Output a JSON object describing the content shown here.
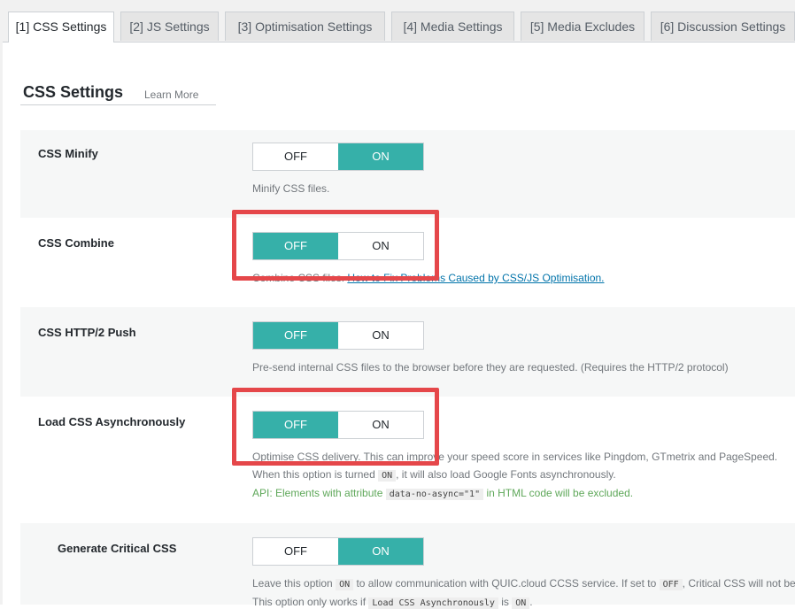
{
  "tabs": [
    {
      "label": "[1] CSS Settings"
    },
    {
      "label": "[2] JS Settings"
    },
    {
      "label": "[3] Optimisation Settings"
    },
    {
      "label": "[4] Media Settings"
    },
    {
      "label": "[5] Media Excludes"
    },
    {
      "label": "[6] Discussion Settings"
    }
  ],
  "section": {
    "title": "CSS Settings",
    "learn_more": "Learn More"
  },
  "toggle_labels": {
    "off": "OFF",
    "on": "ON"
  },
  "settings": [
    {
      "label": "CSS Minify",
      "state": "ON",
      "desc": "Minify CSS files."
    },
    {
      "label": "CSS Combine",
      "state": "OFF",
      "desc_prefix": "Combine CSS files.",
      "desc_link": "How to Fix Problems Caused by CSS/JS Optimisation."
    },
    {
      "label": "CSS HTTP/2 Push",
      "state": "OFF",
      "desc": "Pre-send internal CSS files to the browser before they are requested. (Requires the HTTP/2 protocol)"
    },
    {
      "label": "Load CSS Asynchronously",
      "state": "OFF",
      "desc1": "Optimise CSS delivery. This can improve your speed score in services like Pingdom, GTmetrix and PageSpeed.",
      "desc2_a": "When this option is turned",
      "desc2_code": "ON",
      "desc2_b": ", it will also load Google Fonts asynchronously.",
      "api_a": "API: Elements with attribute",
      "api_code": "data-no-async=\"1\"",
      "api_b": "in HTML code will be excluded."
    },
    {
      "label": "Generate Critical CSS",
      "state": "ON",
      "desc1_a": "Leave this option",
      "desc1_code1": "ON",
      "desc1_b": "to allow communication with QUIC.cloud CCSS service. If set to",
      "desc1_code2": "OFF",
      "desc1_c": ", Critical CSS will not be",
      "desc2_a": "This option only works if",
      "desc2_code1": "Load CSS Asynchronously",
      "desc2_b": "is",
      "desc2_code2": "ON",
      "desc2_c": "."
    }
  ],
  "colors": {
    "accent": "#36b0a9",
    "highlight": "#e5474a",
    "api_text": "#5fa85a",
    "link": "#0073aa"
  }
}
